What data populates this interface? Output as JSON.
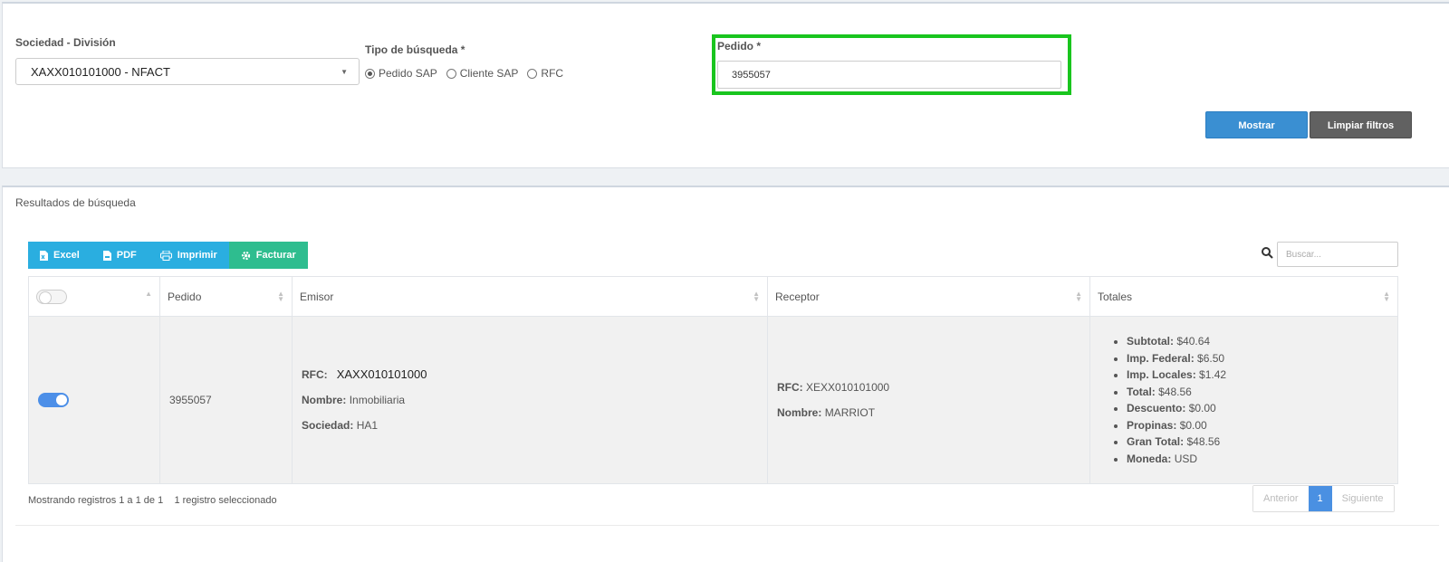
{
  "filters": {
    "sociedad_label": "Sociedad - División",
    "sociedad_value": "XAXX010101000 - NFACT",
    "tipo_label": "Tipo de búsqueda *",
    "tipo_options": [
      "Pedido SAP",
      "Cliente SAP",
      "RFC"
    ],
    "tipo_selected": "Pedido SAP",
    "pedido_label": "Pedido *",
    "pedido_value": "3955057",
    "mostrar": "Mostrar",
    "limpiar": "Limpiar filtros",
    "highlight_color": "#19c51e"
  },
  "results": {
    "title": "Resultados de búsqueda",
    "toolbar": {
      "excel": "Excel",
      "pdf": "PDF",
      "imprimir": "Imprimir",
      "facturar": "Facturar"
    },
    "search_placeholder": "Buscar...",
    "columns": [
      "Pedido",
      "Emisor",
      "Receptor",
      "Totales"
    ],
    "row": {
      "pedido": "3955057",
      "selected": true,
      "emisor": {
        "rfc_label": "RFC:",
        "rfc": "XAXX010101000",
        "nombre_label": "Nombre:",
        "nombre": "Inmobiliaria",
        "sociedad_label": "Sociedad:",
        "sociedad": "HA1"
      },
      "receptor": {
        "rfc_label": "RFC:",
        "rfc": "XEXX010101000",
        "nombre_label": "Nombre:",
        "nombre": "MARRIOT"
      },
      "totales": [
        {
          "label": "Subtotal:",
          "value": "$40.64"
        },
        {
          "label": "Imp. Federal:",
          "value": "$6.50"
        },
        {
          "label": "Imp. Locales:",
          "value": "$1.42"
        },
        {
          "label": "Total:",
          "value": "$48.56"
        },
        {
          "label": "Descuento:",
          "value": "$0.00"
        },
        {
          "label": "Propinas:",
          "value": "$0.00"
        },
        {
          "label": "Gran Total:",
          "value": "$48.56"
        },
        {
          "label": "Moneda:",
          "value": "USD"
        }
      ]
    },
    "info": "Mostrando registros 1 a 1 de 1",
    "selected_info": "1 registro seleccionado",
    "pager": {
      "prev": "Anterior",
      "current": "1",
      "next": "Siguiente"
    }
  }
}
